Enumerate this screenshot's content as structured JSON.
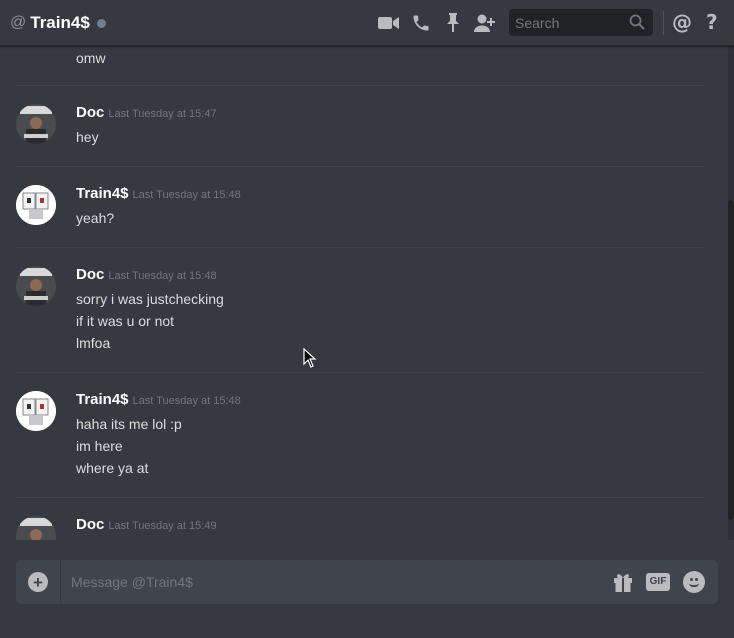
{
  "header": {
    "at_symbol": "@",
    "title": "Train4$",
    "search_placeholder": "Search",
    "icons": [
      "video-call-icon",
      "voice-call-icon",
      "pin-icon",
      "add-friend-icon",
      "search-icon",
      "mention-icon",
      "help-icon"
    ]
  },
  "messages": {
    "continued_text": "omw",
    "groups": [
      {
        "author": "Doc",
        "timestamp": "Last Tuesday at 15:47",
        "lines": [
          "hey"
        ]
      },
      {
        "author": "Train4$",
        "timestamp": "Last Tuesday at 15:48",
        "lines": [
          "yeah?"
        ]
      },
      {
        "author": "Doc",
        "timestamp": "Last Tuesday at 15:48",
        "lines": [
          "sorry i was justchecking",
          "if it was u or not",
          "lmfoa"
        ]
      },
      {
        "author": "Train4$",
        "timestamp": "Last Tuesday at 15:48",
        "lines": [
          "haha its me lol :p",
          "im here",
          "where ya at"
        ]
      },
      {
        "author": "Doc",
        "timestamp": "Last Tuesday at 15:49",
        "lines": []
      }
    ]
  },
  "composer": {
    "placeholder": "Message @Train4$",
    "add_label": "+",
    "gif_label": "GIF"
  },
  "colors": {
    "background": "#36393f",
    "composer_bg": "#40444b",
    "text": "#dcddde",
    "muted": "#72767d"
  }
}
